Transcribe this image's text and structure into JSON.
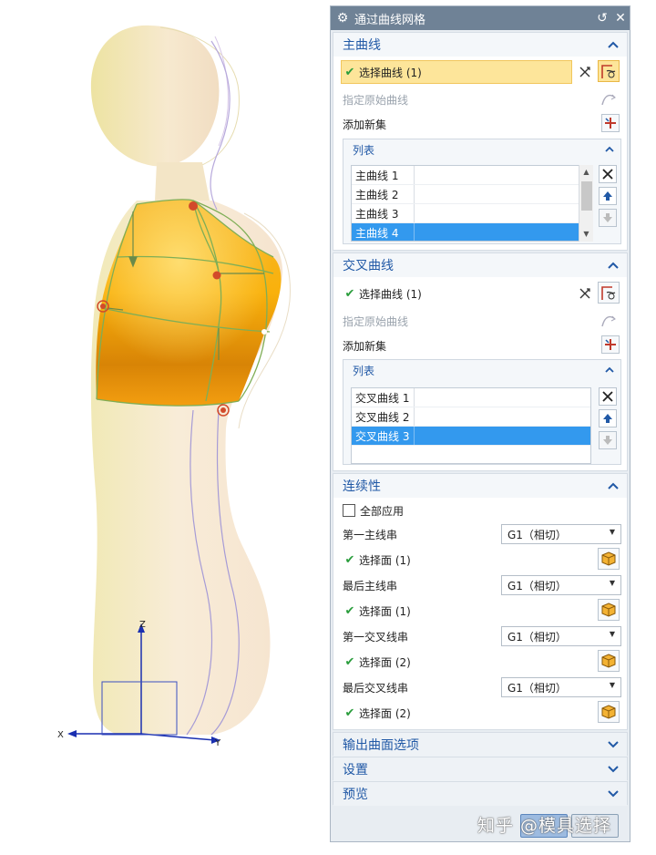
{
  "dialog": {
    "title": "通过曲线网格",
    "reset_icon": "reset-icon",
    "close_icon": "close-icon"
  },
  "primary_curves": {
    "header": "主曲线",
    "select_label": "选择曲线 (1)",
    "specify_origin_label": "指定原始曲线",
    "add_new_set_label": "添加新集",
    "list_header": "列表",
    "items": [
      "主曲线 1",
      "主曲线 2",
      "主曲线 3",
      "主曲线 4"
    ],
    "selected_index": 3
  },
  "cross_curves": {
    "header": "交叉曲线",
    "select_label": "选择曲线 (1)",
    "specify_origin_label": "指定原始曲线",
    "add_new_set_label": "添加新集",
    "list_header": "列表",
    "items": [
      "交叉曲线 1",
      "交叉曲线 2",
      "交叉曲线 3"
    ],
    "selected_index": 2
  },
  "continuity": {
    "header": "连续性",
    "apply_all_label": "全部应用",
    "rows": [
      {
        "label": "第一主线串",
        "value": "G1（相切）",
        "face_label": "选择面 (1)"
      },
      {
        "label": "最后主线串",
        "value": "G1（相切）",
        "face_label": "选择面 (1)"
      },
      {
        "label": "第一交叉线串",
        "value": "G1（相切）",
        "face_label": "选择面 (2)"
      },
      {
        "label": "最后交叉线串",
        "value": "G1（相切）",
        "face_label": "选择面 (2)"
      }
    ]
  },
  "collapsed_sections": [
    "输出曲面选项",
    "设置",
    "预览"
  ],
  "axes": {
    "x": "X",
    "y": "Y",
    "z": "Z"
  },
  "watermark": "知乎 @模具选择",
  "colors": {
    "title_bar": "#6f8296",
    "section_header_text": "#2159a6",
    "selection_highlight": "#fde59a",
    "list_selected": "#3399ee",
    "check_green": "#2a9d3c",
    "surface_orange": "#f5a10f"
  }
}
